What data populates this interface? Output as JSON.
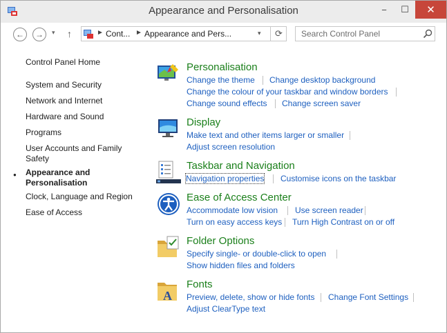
{
  "window": {
    "title": "Appearance and Personalisation"
  },
  "titlebar_buttons": {
    "minimize": "−",
    "maximize": "☐",
    "close": "✕"
  },
  "nav": {
    "back": "←",
    "forward": "→",
    "recent": "▾",
    "up": "↑"
  },
  "address": {
    "crumbs": [
      "Cont...",
      "Appearance and Pers..."
    ],
    "separator": "►",
    "dropdown": "▾",
    "refresh": "⟳"
  },
  "search": {
    "placeholder": "Search Control Panel"
  },
  "sidebar": {
    "items": [
      {
        "label": "Control Panel Home"
      },
      {
        "label": "System and Security"
      },
      {
        "label": "Network and Internet"
      },
      {
        "label": "Hardware and Sound"
      },
      {
        "label": "Programs"
      },
      {
        "label": "User Accounts and Family Safety"
      },
      {
        "label": "Appearance and Personalisation"
      },
      {
        "label": "Clock, Language and Region"
      },
      {
        "label": "Ease of Access"
      }
    ],
    "bullet": "●"
  },
  "sections": [
    {
      "title": "Personalisation",
      "icon": "personalisation-icon",
      "links": [
        "Change the theme",
        "Change desktop background",
        "Change the colour of your taskbar and window borders",
        "Change sound effects",
        "Change screen saver"
      ]
    },
    {
      "title": "Display",
      "icon": "display-icon",
      "links": [
        "Make text and other items larger or smaller",
        "Adjust screen resolution"
      ]
    },
    {
      "title": "Taskbar and Navigation",
      "icon": "taskbar-icon",
      "links": [
        "Navigation properties",
        "Customise icons on the taskbar"
      ]
    },
    {
      "title": "Ease of Access Center",
      "icon": "ease-of-access-icon",
      "links": [
        "Accommodate low vision",
        "Use screen reader",
        "Turn on easy access keys",
        "Turn High Contrast on or off"
      ]
    },
    {
      "title": "Folder Options",
      "icon": "folder-options-icon",
      "links": [
        "Specify single- or double-click to open",
        "Show hidden files and folders"
      ]
    },
    {
      "title": "Fonts",
      "icon": "fonts-icon",
      "links": [
        "Preview, delete, show or hide fonts",
        "Change Font Settings",
        "Adjust ClearType text"
      ]
    }
  ],
  "colors": {
    "title_green": "#1a7f1a",
    "link_blue": "#1d5fbf",
    "close_red": "#c7463a"
  }
}
